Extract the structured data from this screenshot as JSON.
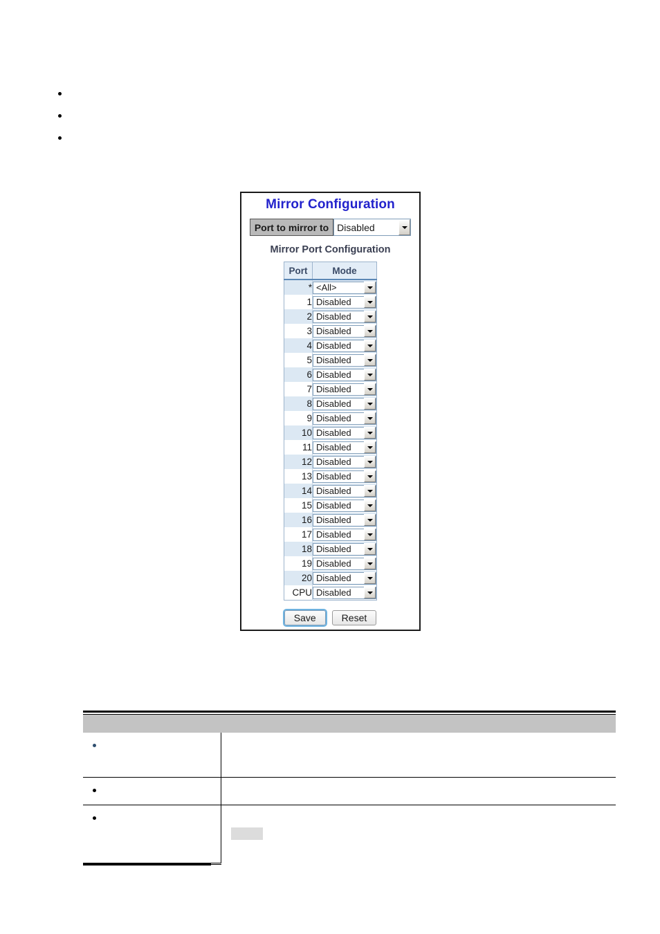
{
  "document": {
    "top_bullets": [
      "",
      "",
      ""
    ]
  },
  "panel": {
    "title": "Mirror Configuration",
    "mirror_to": {
      "label": "Port to mirror to",
      "value": "Disabled",
      "arrow_icon": "chevron-down-icon"
    },
    "section_title": "Mirror Port Configuration",
    "table": {
      "headers": [
        "Port",
        "Mode"
      ],
      "rows": [
        {
          "port": "*",
          "mode": "<All>",
          "alt": true
        },
        {
          "port": "1",
          "mode": "Disabled",
          "alt": false
        },
        {
          "port": "2",
          "mode": "Disabled",
          "alt": true
        },
        {
          "port": "3",
          "mode": "Disabled",
          "alt": false
        },
        {
          "port": "4",
          "mode": "Disabled",
          "alt": true
        },
        {
          "port": "5",
          "mode": "Disabled",
          "alt": false
        },
        {
          "port": "6",
          "mode": "Disabled",
          "alt": true
        },
        {
          "port": "7",
          "mode": "Disabled",
          "alt": false
        },
        {
          "port": "8",
          "mode": "Disabled",
          "alt": true
        },
        {
          "port": "9",
          "mode": "Disabled",
          "alt": false
        },
        {
          "port": "10",
          "mode": "Disabled",
          "alt": true
        },
        {
          "port": "11",
          "mode": "Disabled",
          "alt": false
        },
        {
          "port": "12",
          "mode": "Disabled",
          "alt": true
        },
        {
          "port": "13",
          "mode": "Disabled",
          "alt": false
        },
        {
          "port": "14",
          "mode": "Disabled",
          "alt": true
        },
        {
          "port": "15",
          "mode": "Disabled",
          "alt": false
        },
        {
          "port": "16",
          "mode": "Disabled",
          "alt": true
        },
        {
          "port": "17",
          "mode": "Disabled",
          "alt": false
        },
        {
          "port": "18",
          "mode": "Disabled",
          "alt": true
        },
        {
          "port": "19",
          "mode": "Disabled",
          "alt": false
        },
        {
          "port": "20",
          "mode": "Disabled",
          "alt": true
        },
        {
          "port": "CPU",
          "mode": "Disabled",
          "alt": false
        }
      ]
    },
    "buttons": {
      "save": "Save",
      "reset": "Reset"
    }
  },
  "desc_table": {
    "headers": [
      "",
      ""
    ],
    "rows": [
      {
        "left": "",
        "right": ""
      },
      {
        "left": "",
        "right": ""
      },
      {
        "left": "",
        "right": ""
      }
    ]
  },
  "colors": {
    "panel_title": "#2222cc",
    "section_title": "#3a3f52",
    "table_header_bg": "#e3edf7",
    "row_alt_bg": "#dce8f3",
    "label_bg": "#b9b9b9",
    "desc_header_bg": "#c3c3c3",
    "chip_bg": "#dcdcdc"
  }
}
